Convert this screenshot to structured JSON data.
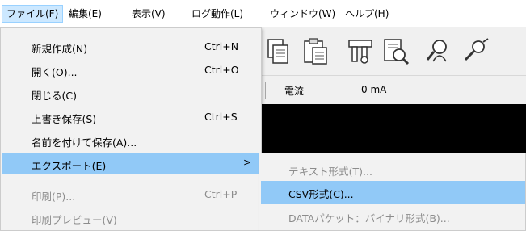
{
  "menubar": {
    "items": [
      {
        "label": "ファイル(F)"
      },
      {
        "label": "編集(E)"
      },
      {
        "label": "表示(V)"
      },
      {
        "label": "ログ動作(L)"
      },
      {
        "label": "ウィンドウ(W)"
      },
      {
        "label": "ヘルプ(H)"
      }
    ]
  },
  "toolbar": {
    "icons": [
      "copy-icon",
      "paste-icon",
      "settings-tool-icon",
      "document-search-icon",
      "user-search-icon",
      "pin-icon"
    ]
  },
  "status": {
    "label": "電流",
    "value": "0 mA"
  },
  "file_menu": {
    "items": [
      {
        "label": "新規作成(N)",
        "shortcut": "Ctrl+N",
        "state": "enabled"
      },
      {
        "label": "開く(O)...",
        "shortcut": "Ctrl+O",
        "state": "enabled"
      },
      {
        "label": "閉じる(C)",
        "shortcut": "",
        "state": "enabled"
      },
      {
        "label": "上書き保存(S)",
        "shortcut": "Ctrl+S",
        "state": "enabled"
      },
      {
        "label": "名前を付けて保存(A)...",
        "shortcut": "",
        "state": "enabled"
      },
      {
        "label": "エクスポート(E)",
        "shortcut": "",
        "state": "highlighted",
        "submenu_arrow": ">"
      },
      {
        "label": "印刷(P)...",
        "shortcut": "Ctrl+P",
        "state": "disabled"
      },
      {
        "label": "印刷プレビュー(V)",
        "shortcut": "",
        "state": "disabled"
      }
    ]
  },
  "export_submenu": {
    "items": [
      {
        "label": "テキスト形式(T)...",
        "state": "disabled"
      },
      {
        "label": "CSV形式(C)...",
        "state": "highlighted"
      },
      {
        "label": "DATAパケット：バイナリ形式(B)...",
        "state": "disabled"
      }
    ]
  },
  "colors": {
    "menu_highlight": "#91c9f7",
    "menubar_active": "#cce8ff",
    "disabled_text": "#8c8c8c",
    "data_area": "#000000"
  }
}
